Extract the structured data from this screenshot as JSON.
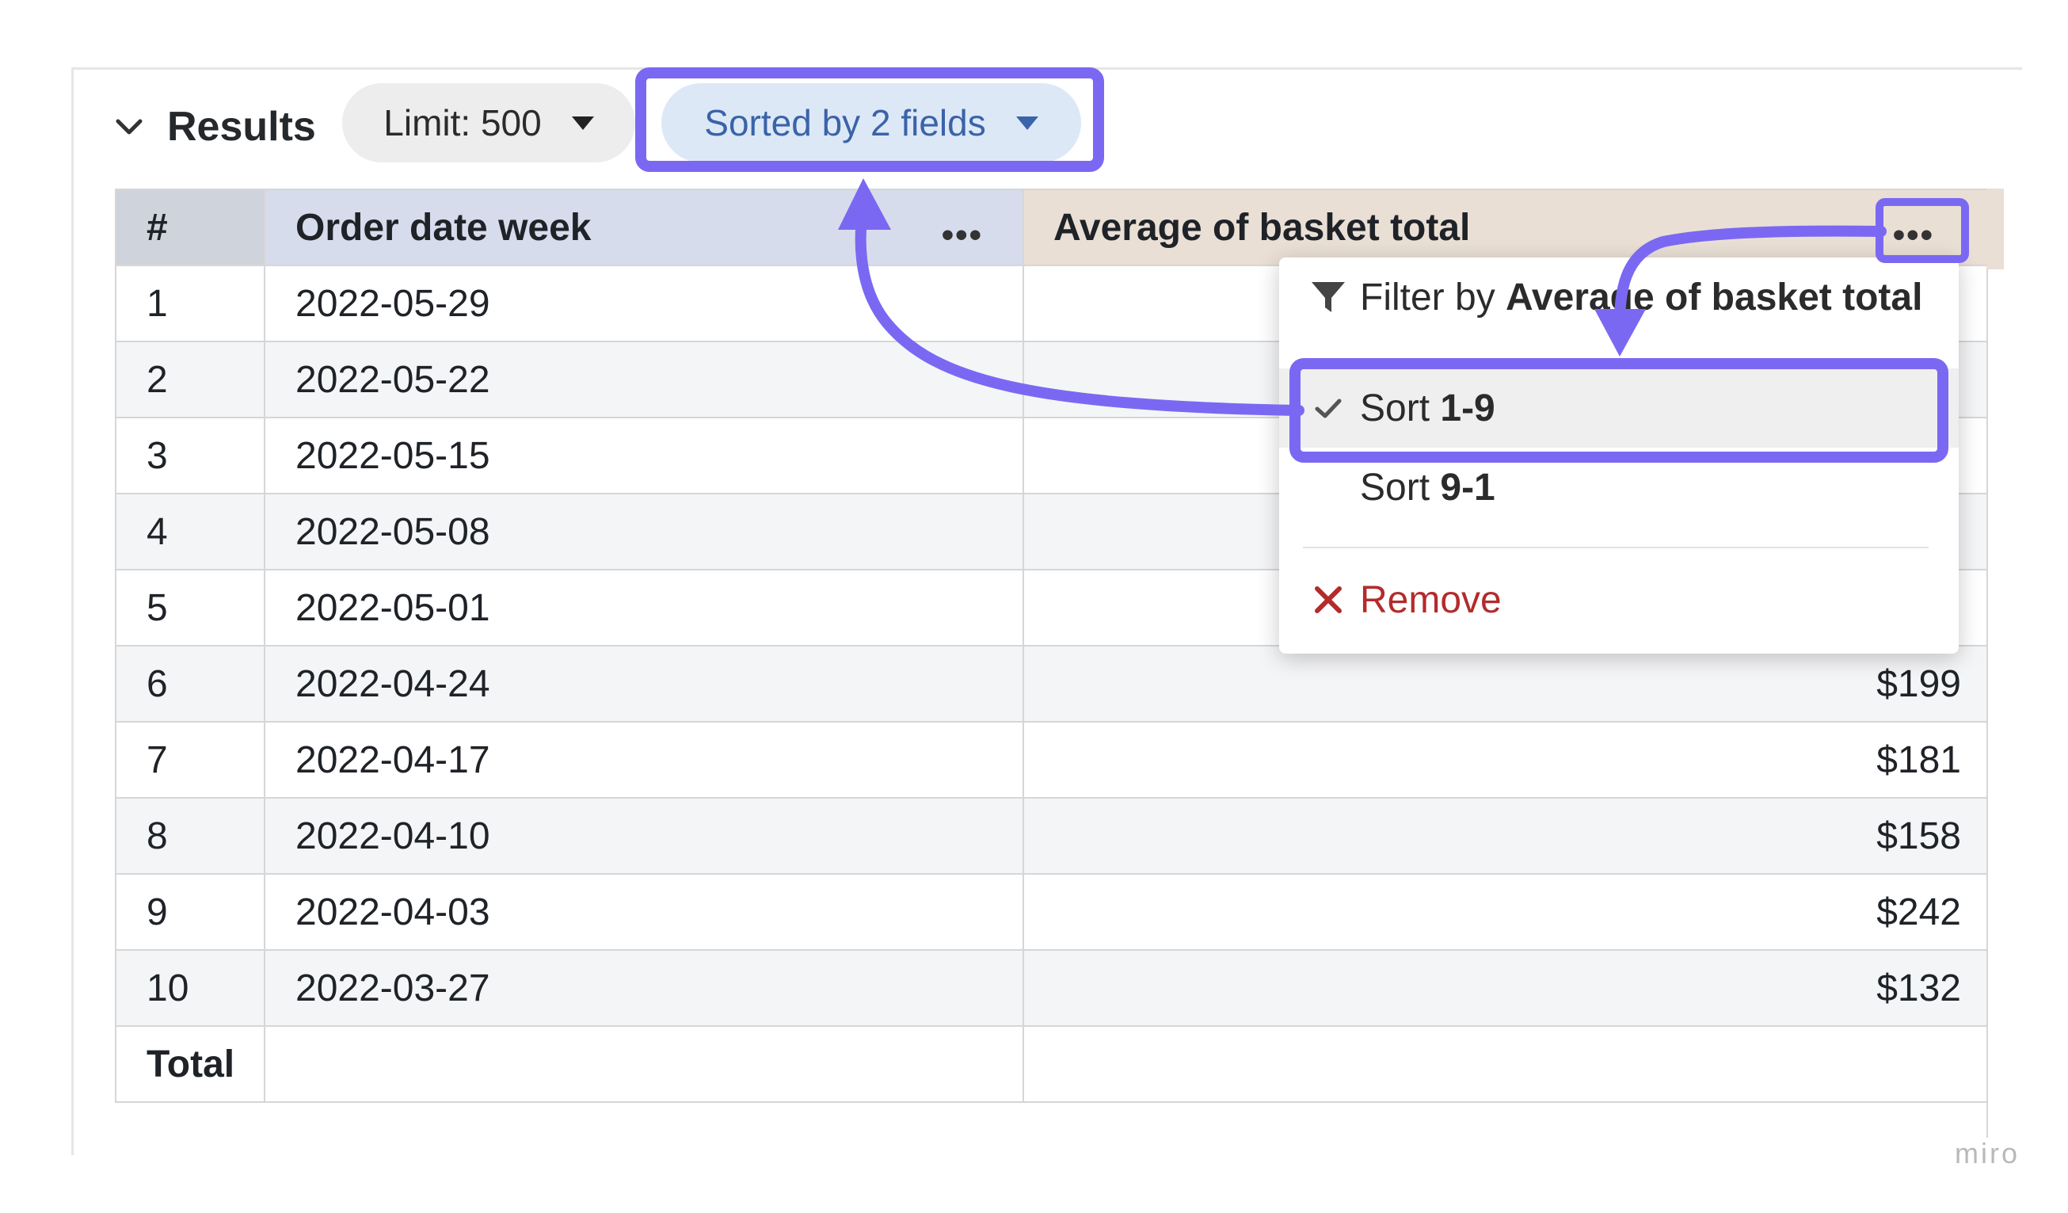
{
  "results": {
    "title": "Results",
    "limit_label": "Limit: 500",
    "sorted_label": "Sorted by 2 fields"
  },
  "table": {
    "columns": [
      "#",
      "Order date week",
      "Average of basket total"
    ],
    "rows": [
      {
        "n": "1",
        "week": "2022-05-29",
        "avg": ""
      },
      {
        "n": "2",
        "week": "2022-05-22",
        "avg": ""
      },
      {
        "n": "3",
        "week": "2022-05-15",
        "avg": ""
      },
      {
        "n": "4",
        "week": "2022-05-08",
        "avg": ""
      },
      {
        "n": "5",
        "week": "2022-05-01",
        "avg": ""
      },
      {
        "n": "6",
        "week": "2022-04-24",
        "avg": "$199"
      },
      {
        "n": "7",
        "week": "2022-04-17",
        "avg": "$181"
      },
      {
        "n": "8",
        "week": "2022-04-10",
        "avg": "$158"
      },
      {
        "n": "9",
        "week": "2022-04-03",
        "avg": "$242"
      },
      {
        "n": "10",
        "week": "2022-03-27",
        "avg": "$132"
      }
    ],
    "total_label": "Total"
  },
  "menu": {
    "filter_prefix": "Filter by ",
    "filter_field": "Average of basket total",
    "sort_prefix": "Sort ",
    "sort_asc": "1-9",
    "sort_desc": "9-1",
    "remove": "Remove"
  },
  "annotation": {
    "accent": "#7b68f2"
  },
  "watermark": "miro"
}
